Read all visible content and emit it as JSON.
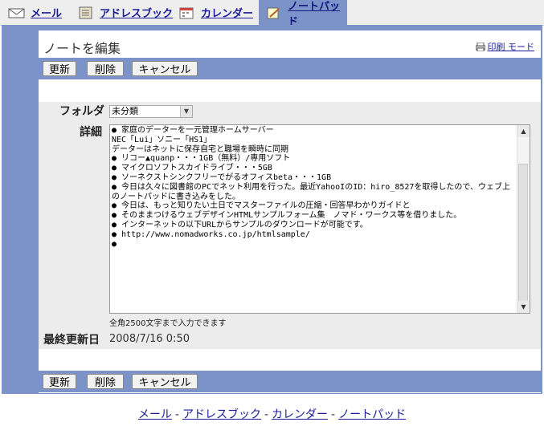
{
  "tabs": [
    {
      "label": "メール",
      "icon": "mail-icon"
    },
    {
      "label": "アドレスブック",
      "icon": "address-book-icon"
    },
    {
      "label": "カレンダー",
      "icon": "calendar-icon"
    },
    {
      "label": "ノートパッド",
      "icon": "notepad-icon",
      "active": true
    }
  ],
  "page": {
    "title": "ノートを編集",
    "print_link": "印刷 モード"
  },
  "toolbar": {
    "update_label": "更新",
    "delete_label": "削除",
    "cancel_label": "キャンセル"
  },
  "form": {
    "folder_label": "フォルダ",
    "folder_value": "未分類",
    "detail_label": "詳細",
    "detail_text": "● 家庭のデーターを一元管理ホームサーバー\nNEC「Lui」ソニー「HS1」\nデーターはネットに保存自宅と職場を瞬時に同期\n● リコー▲quanp・・・1GB（無料）/専用ソフト\n● マイクロソフトスカイドライブ・・・5GB\n● ソーネクストシンクフリーでがるオフィスbeta・・・1GB\n● 今日は久々に図書館のPCでネット利用を行った。最近YahooIのID：hiro_8527を取得したので、ウェブ上のノートパッドに書き込みをした。\n● 今日は、もっと知りたい土日でマスターファイルの圧縮・回答早わかりガイドと\n● そのままつけるウェブデザインHTMLサンプルフォーム集　ノマド・ワークス等を借りました。\n● インターネットの以下URLからサンプルのダウンロードが可能です。\n● http://www.nomadworks.co.jp/htmlsample/\n●",
    "char_limit_note": "全角2500文字まで入力できます",
    "last_updated_label": "最終更新日",
    "last_updated_value": "2008/7/16 0:50"
  },
  "footer": {
    "links": [
      "メール",
      "アドレスブック",
      "カレンダー",
      "ノートパッド"
    ]
  },
  "colors": {
    "accent": "#7c93c9",
    "link": "#1a1a9c",
    "form_bg": "#ececec"
  }
}
